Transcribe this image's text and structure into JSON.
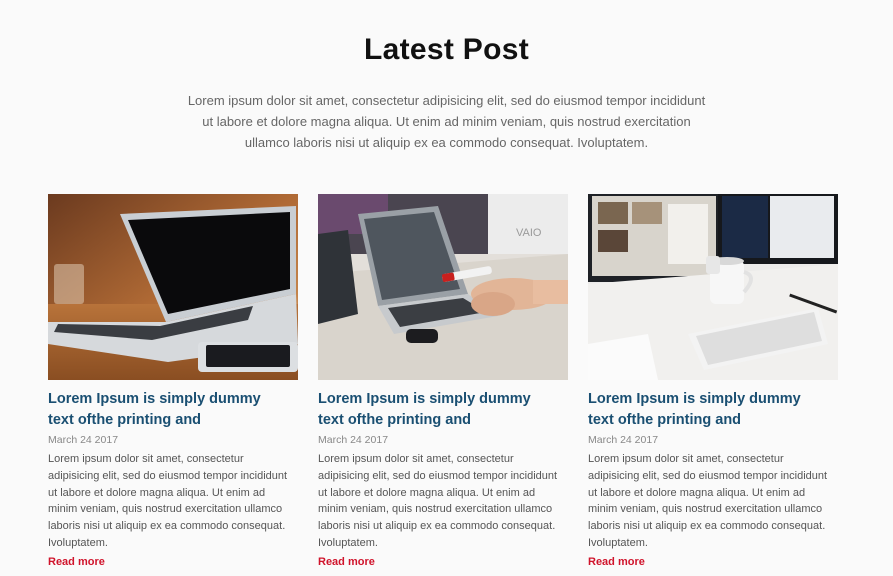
{
  "header": {
    "title": "Latest Post",
    "intro": "Lorem ipsum dolor sit amet, consectetur adipisicing elit, sed do eiusmod tempor incididunt ut labore et dolore magna aliqua. Ut enim ad minim veniam, quis nostrud exercitation ullamco laboris nisi ut aliquip ex ea commodo consequat. Ivoluptatem."
  },
  "posts": [
    {
      "image": "laptop-on-table",
      "title": "Lorem Ipsum is simply dummy text ofthe printing and",
      "date": "March 24 2017",
      "excerpt": "Lorem ipsum dolor sit amet, consectetur adipisicing elit, sed do eiusmod tempor incididunt ut labore et dolore magna aliqua. Ut enim ad minim veniam, quis nostrud exercitation ullamco laboris nisi ut aliquip ex ea commodo consequat. Ivoluptatem.",
      "link": "Read more"
    },
    {
      "image": "hands-with-laptops",
      "title": "Lorem Ipsum is simply dummy text ofthe printing and",
      "date": "March 24 2017",
      "excerpt": "Lorem ipsum dolor sit amet, consectetur adipisicing elit, sed do eiusmod tempor incididunt ut labore et dolore magna aliqua. Ut enim ad minim veniam, quis nostrud exercitation ullamco laboris nisi ut aliquip ex ea commodo consequat. Ivoluptatem.",
      "link": "Read more"
    },
    {
      "image": "desk-with-monitors-and-mug",
      "title": "Lorem Ipsum is simply dummy text ofthe printing and",
      "date": "March 24 2017",
      "excerpt": "Lorem ipsum dolor sit amet, consectetur adipisicing elit, sed do eiusmod tempor incididunt ut labore et dolore magna aliqua. Ut enim ad minim veniam, quis nostrud exercitation ullamco laboris nisi ut aliquip ex ea commodo consequat. Ivoluptatem.",
      "link": "Read more"
    }
  ],
  "colors": {
    "title": "#111111",
    "post_title": "#1a4f72",
    "read_more": "#d0142c"
  }
}
